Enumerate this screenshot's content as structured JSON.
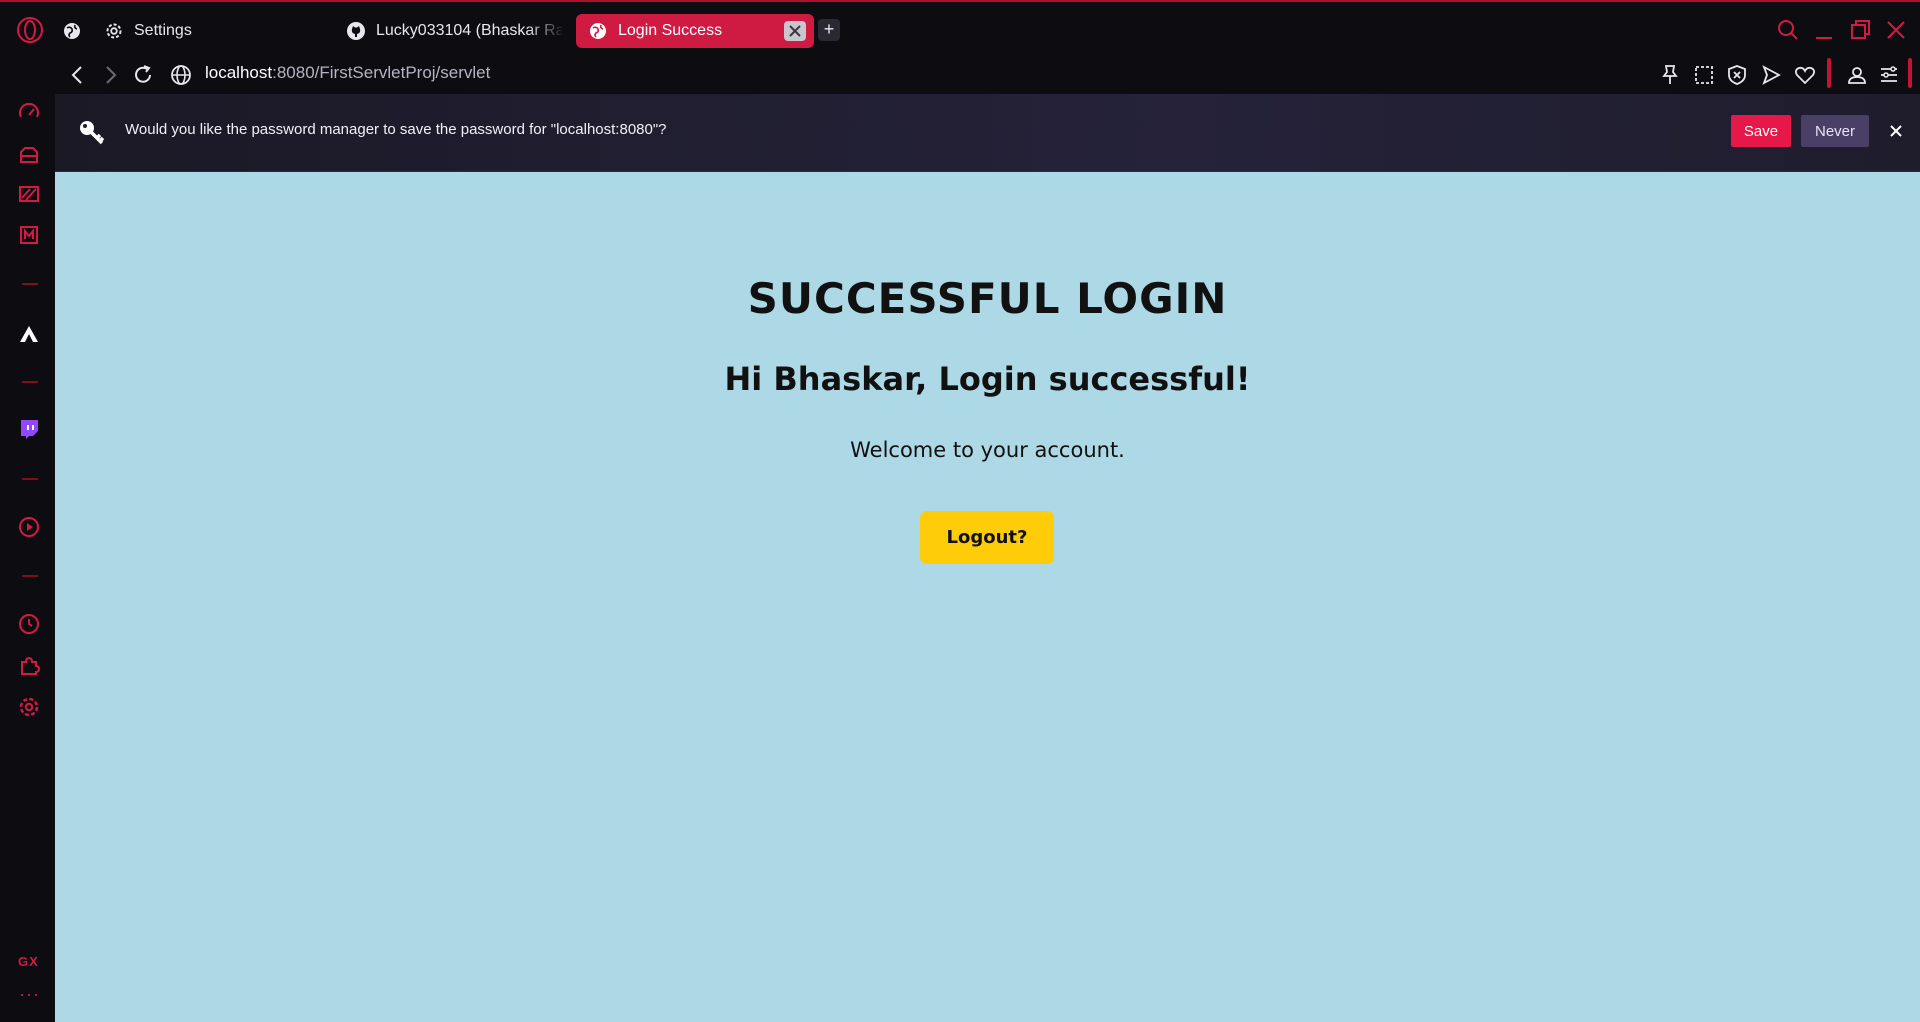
{
  "browser": {
    "tabs": [
      {
        "label": "Settings"
      },
      {
        "label": "Lucky033104 (Bhaskar Ra"
      },
      {
        "label": "Login Success"
      }
    ],
    "new_tab": "+",
    "url_host": "localhost",
    "url_rest": ":8080/FirstServletProj/servlet",
    "accent_color": "#cf1a42"
  },
  "sidebar": {
    "gx_label": "GX",
    "more": "···"
  },
  "password_bar": {
    "message": "Would you like the password manager to save the password for \"localhost:8080\"?",
    "save_label": "Save",
    "never_label": "Never"
  },
  "page": {
    "background": "#add8e6",
    "title": "SUCCESSFUL LOGIN",
    "greeting": "Hi Bhaskar, Login successful!",
    "welcome": "Welcome to your account.",
    "logout_label": "Logout?",
    "logout_color": "#ffcc0a"
  }
}
